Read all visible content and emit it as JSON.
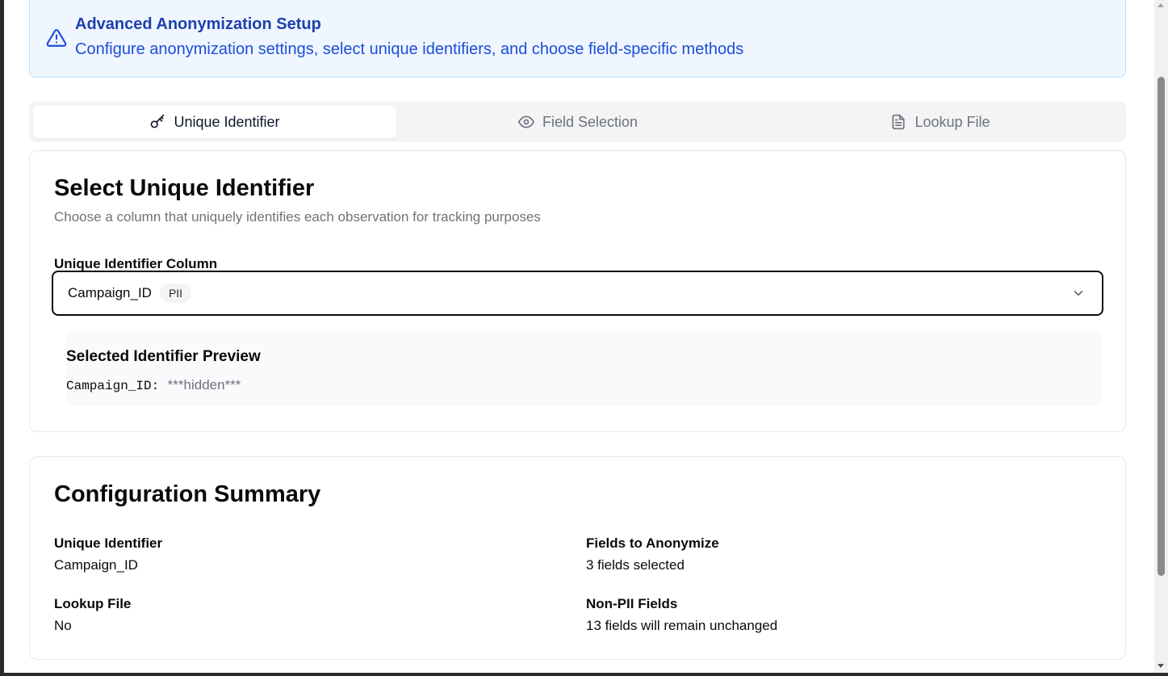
{
  "alert": {
    "icon": "warning-triangle-icon",
    "title": "Advanced Anonymization Setup",
    "description": "Configure anonymization settings, select unique identifiers, and choose field-specific methods",
    "colors": {
      "background": "#eff6ff",
      "border": "#bfdbfe",
      "text": "#1d4ed8"
    }
  },
  "tabs": [
    {
      "label": "Unique Identifier",
      "icon": "key-icon",
      "active": true
    },
    {
      "label": "Field Selection",
      "icon": "eye-icon",
      "active": false
    },
    {
      "label": "Lookup File",
      "icon": "file-text-icon",
      "active": false
    }
  ],
  "unique_identifier": {
    "title": "Select Unique Identifier",
    "description": "Choose a column that uniquely identifies each observation for tracking purposes",
    "field_label": "Unique Identifier Column",
    "selected_value": "Campaign_ID",
    "selected_badge": "PII",
    "preview": {
      "title": "Selected Identifier Preview",
      "key": "Campaign_ID:",
      "value": "***hidden***"
    }
  },
  "summary": {
    "title": "Configuration Summary",
    "items": [
      {
        "label": "Unique Identifier",
        "value": "Campaign_ID"
      },
      {
        "label": "Fields to Anonymize",
        "value": "3 fields selected"
      },
      {
        "label": "Lookup File",
        "value": "No"
      },
      {
        "label": "Non-PII Fields",
        "value": "13 fields will remain unchanged"
      }
    ]
  }
}
